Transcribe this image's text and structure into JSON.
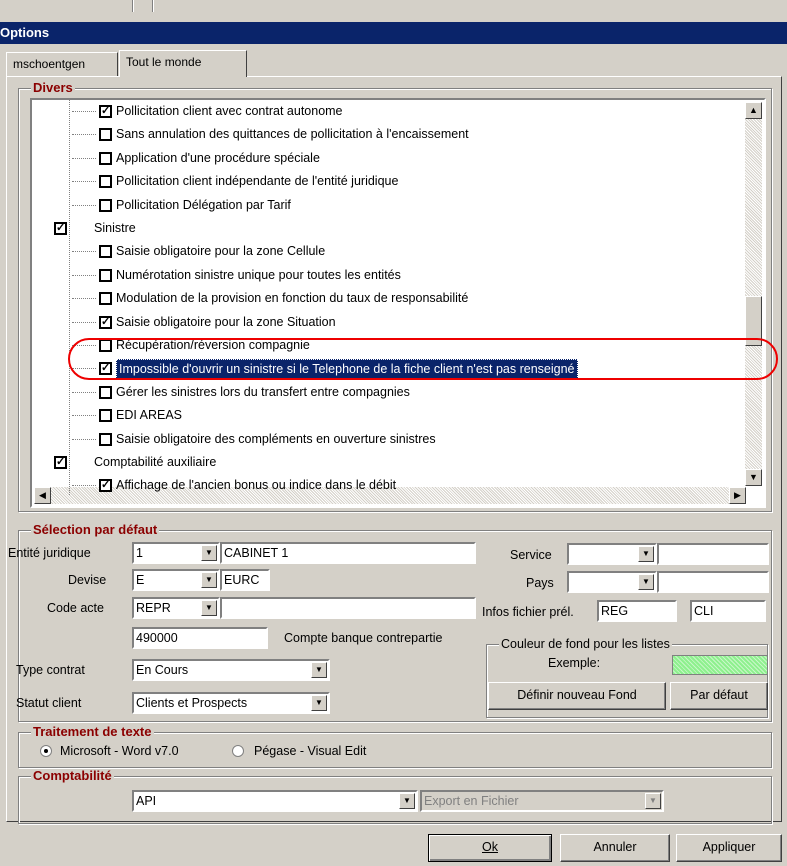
{
  "window": {
    "title": "Options"
  },
  "tabs": [
    {
      "label": "mschoentgen"
    },
    {
      "label": "Tout le monde"
    }
  ],
  "divers": {
    "title": "Divers",
    "items": [
      {
        "label": "Pollicitation client avec contrat autonome",
        "checked": true
      },
      {
        "label": "Sans annulation des quittances de pollicitation à l'encaissement",
        "checked": false
      },
      {
        "label": "Application d'une procédure spéciale",
        "checked": false
      },
      {
        "label": "Pollicitation client indépendante de l'entité juridique",
        "checked": false
      },
      {
        "label": "Pollicitation Délégation par Tarif",
        "checked": false
      },
      {
        "label": "Sinistre",
        "checked": true,
        "group": true
      },
      {
        "label": "Saisie obligatoire pour la zone Cellule",
        "checked": false
      },
      {
        "label": "Numérotation sinistre unique pour toutes les entités",
        "checked": false
      },
      {
        "label": "Modulation de la provision en fonction du taux de responsabilité",
        "checked": false
      },
      {
        "label": "Saisie obligatoire pour la zone Situation",
        "checked": true
      },
      {
        "label": "Récupération/réversion compagnie",
        "checked": false
      },
      {
        "label": "Impossible d'ouvrir un sinistre si le Telephone de la fiche client n'est pas renseigné",
        "checked": true,
        "selected": true
      },
      {
        "label": "Gérer les sinistres lors du transfert entre compagnies",
        "checked": false
      },
      {
        "label": "EDI AREAS",
        "checked": false
      },
      {
        "label": "Saisie obligatoire des compléments en ouverture sinistres",
        "checked": false
      },
      {
        "label": "Comptabilité auxiliaire",
        "checked": true,
        "group": true
      },
      {
        "label": "Affichage de l'ancien bonus ou indice dans le débit",
        "checked": true
      }
    ]
  },
  "selection": {
    "title": "Sélection par défaut",
    "entite_label": "Entité juridique",
    "entite_code": "1",
    "entite_name": "CABINET 1",
    "devise_label": "Devise",
    "devise_code": "E",
    "devise_name": "EURC",
    "code_acte_label": "Code acte",
    "code_acte": "REPR",
    "compte_value": "490000",
    "compte_label": "Compte banque contrepartie",
    "type_contrat_label": "Type contrat",
    "type_contrat": "En Cours",
    "statut_label": "Statut client",
    "statut": "Clients et Prospects",
    "service_label": "Service",
    "service": "",
    "pays_label": "Pays",
    "pays": "",
    "infos_label": "Infos fichier prél.",
    "infos_1": "REG",
    "infos_2": "CLI",
    "couleur_title": "Couleur de fond pour les listes",
    "exemple_label": "Exemple:",
    "swatch_color": "#8ef08e",
    "definir_btn": "Définir nouveau Fond",
    "defaut_btn": "Par défaut"
  },
  "traitement": {
    "title": "Traitement de texte",
    "opt1": "Microsoft - Word v7.0",
    "opt2": "Pégase - Visual Edit",
    "selected": "opt1"
  },
  "compta": {
    "title": "Comptabilité",
    "value": "API",
    "export": "Export en Fichier"
  },
  "footer": {
    "ok": "Ok",
    "annuler": "Annuler",
    "appliquer": "Appliquer"
  }
}
